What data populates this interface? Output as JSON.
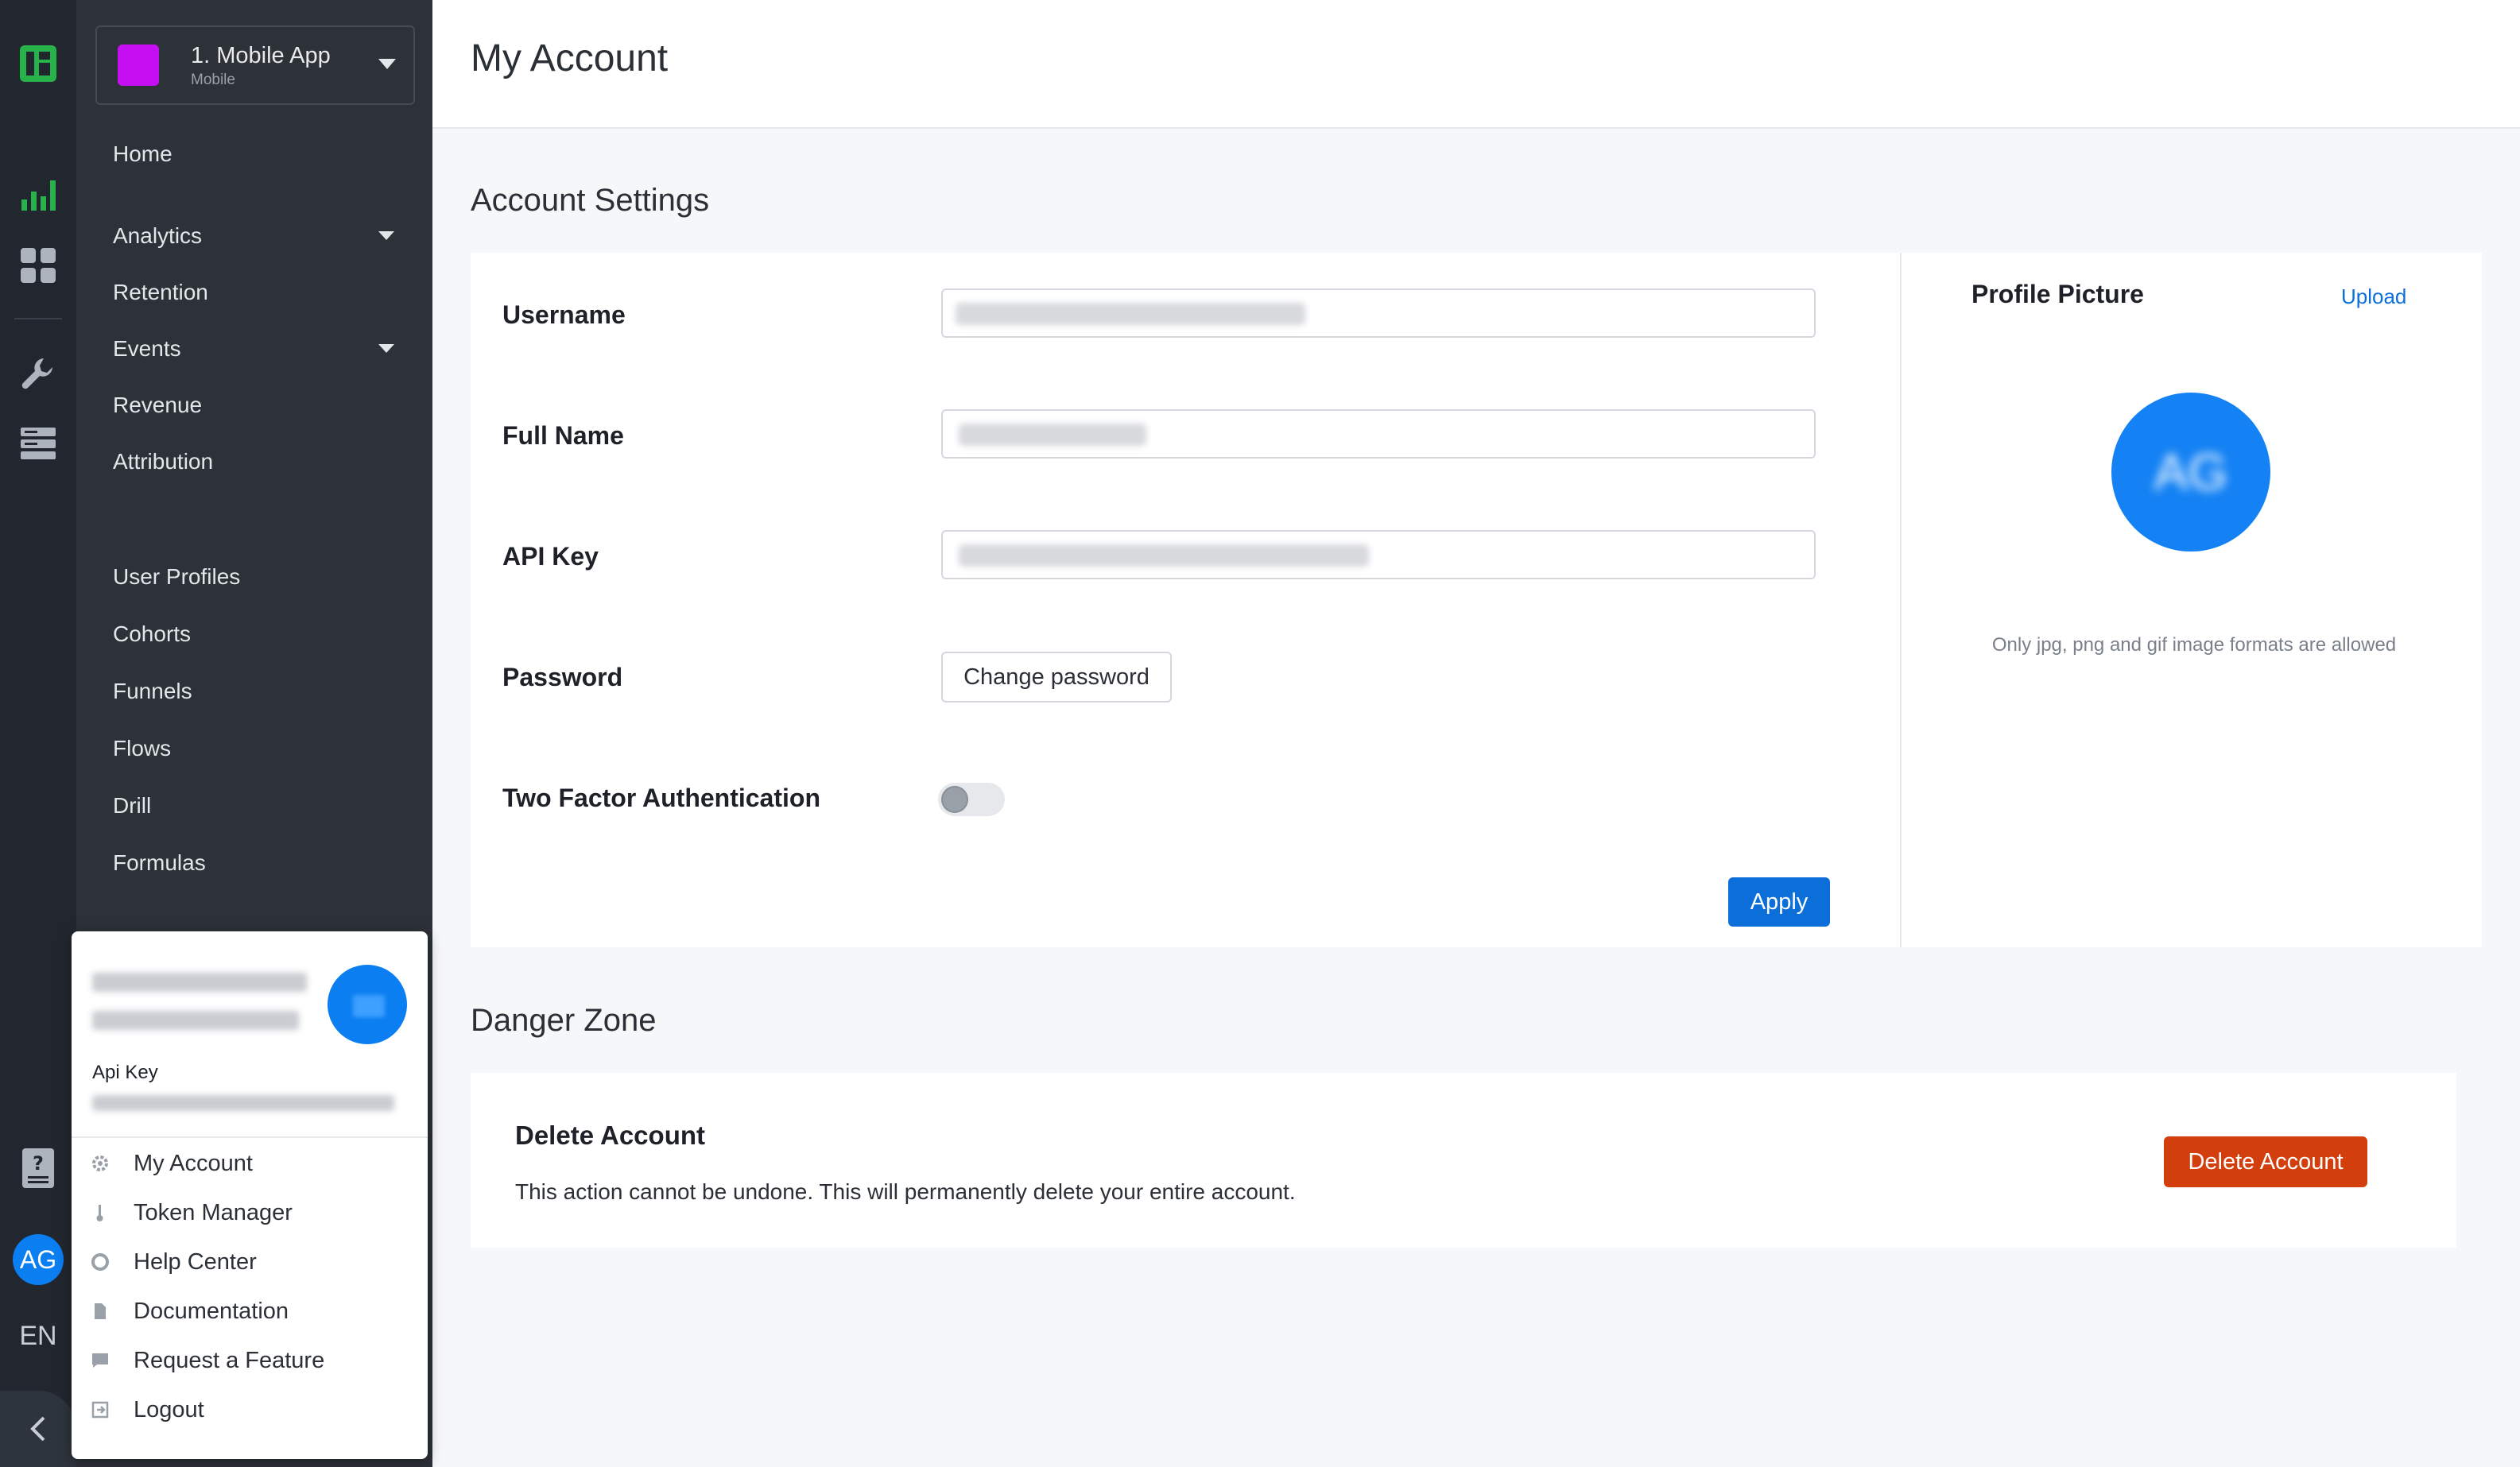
{
  "app_select": {
    "name": "1. Mobile App",
    "sub": "Mobile",
    "color": "#c50ef1"
  },
  "sidebar": {
    "items": [
      {
        "label": "Home"
      },
      {
        "label": "Analytics"
      },
      {
        "label": "Retention"
      },
      {
        "label": "Events"
      },
      {
        "label": "Revenue"
      },
      {
        "label": "Attribution"
      },
      {
        "label": "User Profiles"
      },
      {
        "label": "Cohorts"
      },
      {
        "label": "Funnels"
      },
      {
        "label": "Flows"
      },
      {
        "label": "Drill"
      },
      {
        "label": "Formulas"
      }
    ]
  },
  "rail": {
    "avatar_initials": "AG",
    "language": "EN"
  },
  "page": {
    "title": "My Account"
  },
  "account_settings": {
    "title": "Account Settings",
    "username_label": "Username",
    "full_name_label": "Full Name",
    "api_key_label": "API Key",
    "password_label": "Password",
    "change_password_label": "Change password",
    "two_factor_label": "Two Factor Authentication",
    "two_factor_enabled": false,
    "apply_label": "Apply"
  },
  "profile_picture": {
    "title": "Profile Picture",
    "upload_label": "Upload",
    "hint": "Only jpg, png and gif image formats are allowed"
  },
  "danger_zone": {
    "title": "Danger Zone",
    "delete_title": "Delete Account",
    "delete_desc": "This action cannot be undone. This will permanently delete your entire account.",
    "delete_button": "Delete Account"
  },
  "user_menu": {
    "api_key_label": "Api Key",
    "items": [
      {
        "label": "My Account",
        "icon": "gear-icon"
      },
      {
        "label": "Token Manager",
        "icon": "key-icon"
      },
      {
        "label": "Help Center",
        "icon": "lifebuoy-icon"
      },
      {
        "label": "Documentation",
        "icon": "document-icon"
      },
      {
        "label": "Request a Feature",
        "icon": "chat-icon"
      },
      {
        "label": "Logout",
        "icon": "logout-icon"
      }
    ]
  },
  "colors": {
    "primary": "#0c6fd9",
    "danger": "#d33f0c",
    "accent_green": "#27b34a",
    "avatar_blue": "#0b7ef1"
  }
}
